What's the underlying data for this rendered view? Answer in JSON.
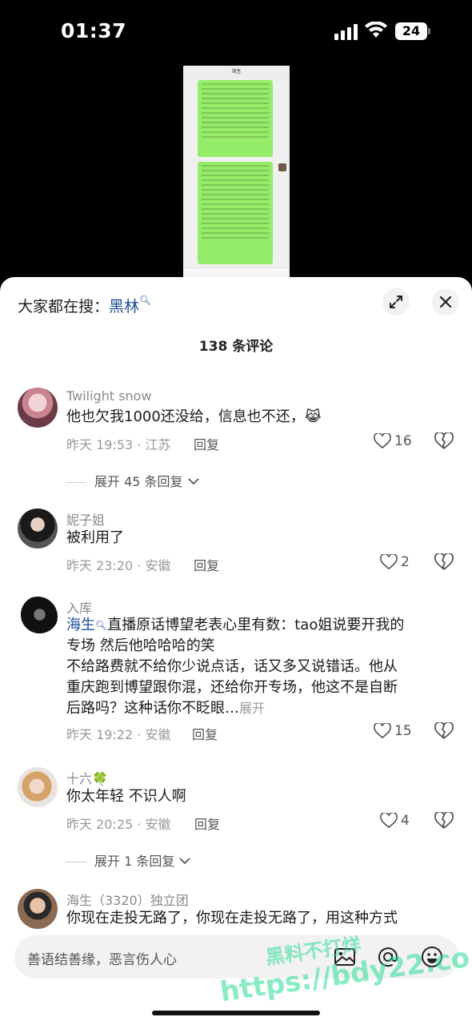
{
  "status_bar": {
    "time": "01:37",
    "battery": "24"
  },
  "video": {
    "chat_title": "海生"
  },
  "sheet": {
    "search_prefix": "大家都在搜：",
    "search_keyword": "黑林",
    "comment_count": "138 条评论"
  },
  "comments": [
    {
      "user": "Twilight snow",
      "text": "他也欠我1000还没给，信息也不还，😹",
      "meta": "昨天 19:53 · 江苏",
      "reply": "回复",
      "likes": "16",
      "more": "展开 45 条回复"
    },
    {
      "user": "妮子姐",
      "text": "被利用了",
      "meta": "昨天 23:20 · 安徽",
      "reply": "回复",
      "likes": "2"
    },
    {
      "user": "入库",
      "mention": "海生",
      "line1": "直播原话博望老表心里有数：tao姐说要开我的",
      "line2": "专场 然后他哈哈哈的笑",
      "line3": "不给路费就不给你少说点话，话又多又说错话。他从",
      "line4": "重庆跑到博望跟你混，还给你开专场，他这不是自断",
      "line5": "后路吗？这种话你不眨眼…",
      "expand": "展开",
      "meta": "昨天 19:22 · 安徽",
      "reply": "回复",
      "likes": "15"
    },
    {
      "user": "十六🍀",
      "text": "你太年轻 不识人啊",
      "meta": "昨天 20:25 · 安徽",
      "reply": "回复",
      "likes": "4",
      "more": "展开 1 条回复"
    },
    {
      "user": "海生（3320）独立团",
      "text": "你现在走投无路了，你现在走投无路了，用这种方式"
    }
  ],
  "input": {
    "placeholder": "善语结善缘，恶言伤人心"
  },
  "watermark": {
    "line1": "黑料不打烊",
    "line2": "https://bdy22.co"
  },
  "colors": {
    "accent": "#1b4f9a",
    "bubble": "#95ec69"
  }
}
